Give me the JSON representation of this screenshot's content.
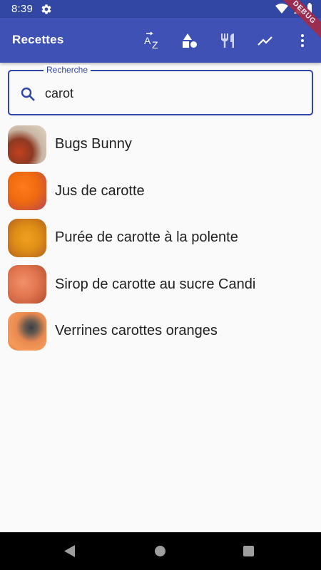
{
  "status": {
    "time": "8:39"
  },
  "app": {
    "title": "Recettes"
  },
  "debug": {
    "label": "DEBUG"
  },
  "search": {
    "label": "Recherche",
    "value": "carot"
  },
  "recipes": [
    {
      "name": "Bugs Bunny"
    },
    {
      "name": "Jus de carotte"
    },
    {
      "name": "Purée de carotte à la polente"
    },
    {
      "name": "Sirop de carotte au sucre Candi"
    },
    {
      "name": "Verrines carottes oranges"
    }
  ],
  "colors": {
    "primary": "#3f51b5",
    "primary_dark": "#3246a3",
    "ribbon": "#a52a46"
  }
}
